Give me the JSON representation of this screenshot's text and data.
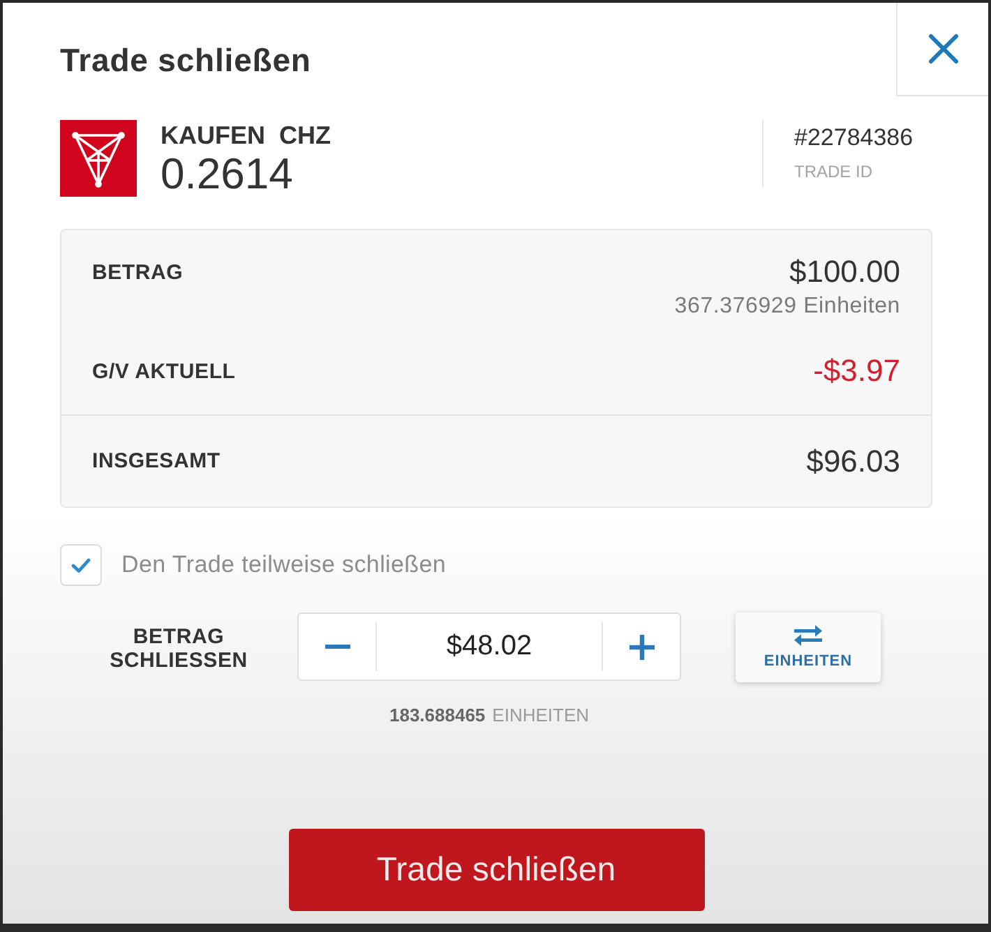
{
  "dialog": {
    "title": "Trade schließen"
  },
  "position": {
    "action": "KAUFEN",
    "symbol": "CHZ",
    "rate": "0.2614",
    "trade_id": "#22784386",
    "trade_id_label": "TRADE ID"
  },
  "summary": {
    "rows": [
      {
        "kind": "plain",
        "label": "BETRAG",
        "value": "$100.00",
        "sub": "367.376929 Einheiten"
      },
      {
        "kind": "loss",
        "label": "G/V AKTUELL",
        "value": "-$3.97"
      }
    ],
    "total": {
      "label": "INSGESAMT",
      "value": "$96.03"
    }
  },
  "partial_close": {
    "label": "Den Trade teilweise schließen",
    "checked": true
  },
  "amount": {
    "label": "BETRAG SCHLIESSEN",
    "value": "$48.02",
    "units": "183.688465",
    "units_label": "EINHEITEN",
    "toggle": "EINHEITEN"
  },
  "submit": {
    "label": "Trade schließen"
  }
}
